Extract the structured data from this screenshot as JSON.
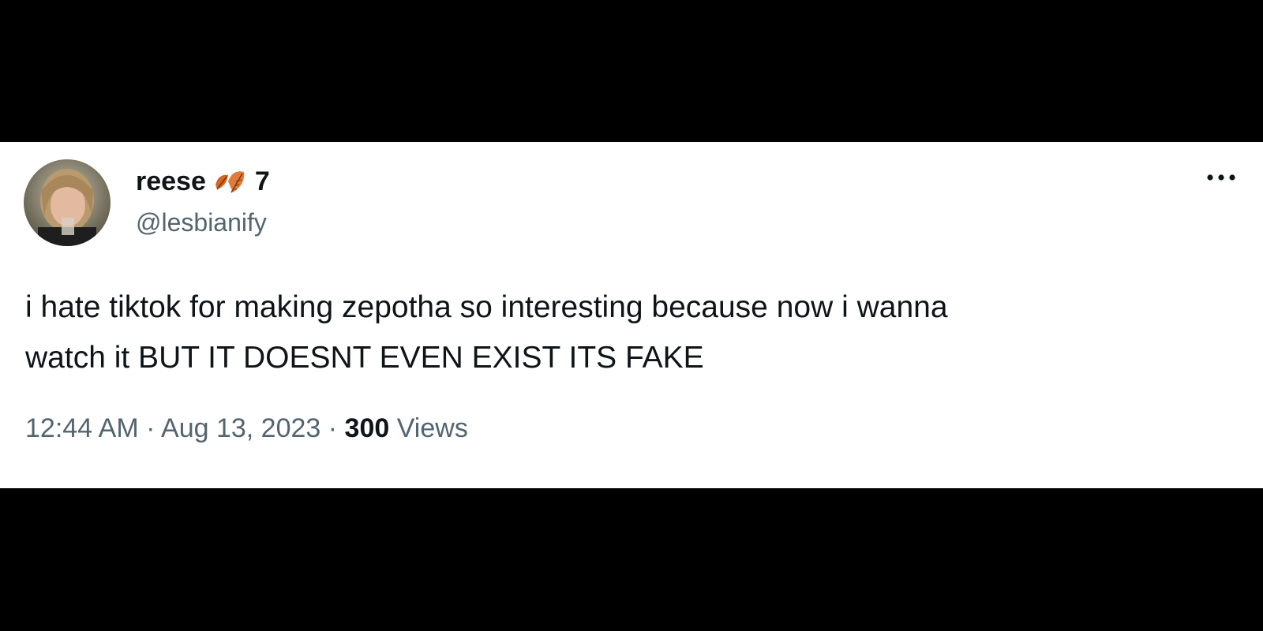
{
  "tweet": {
    "author": {
      "display_name": "reese",
      "name_emoji": "leaf-emoji",
      "name_suffix": "7",
      "handle": "@lesbianify"
    },
    "text_lines": [
      "i hate tiktok for making zepotha so interesting because now i wanna",
      "watch it BUT IT DOESNT EVEN EXIST ITS FAKE"
    ],
    "time": "12:44 AM",
    "separator": "·",
    "date": "Aug 13, 2023",
    "views_count": "300",
    "views_label": "Views"
  },
  "icons": {
    "more": "more-horizontal-icon",
    "leaf": "fallen-leaf-icon",
    "avatar": "user-avatar-photo"
  },
  "colors": {
    "background": "#000000",
    "card": "#ffffff",
    "primary_text": "#0f1419",
    "secondary_text": "#536471",
    "leaf": "#d2691e"
  }
}
